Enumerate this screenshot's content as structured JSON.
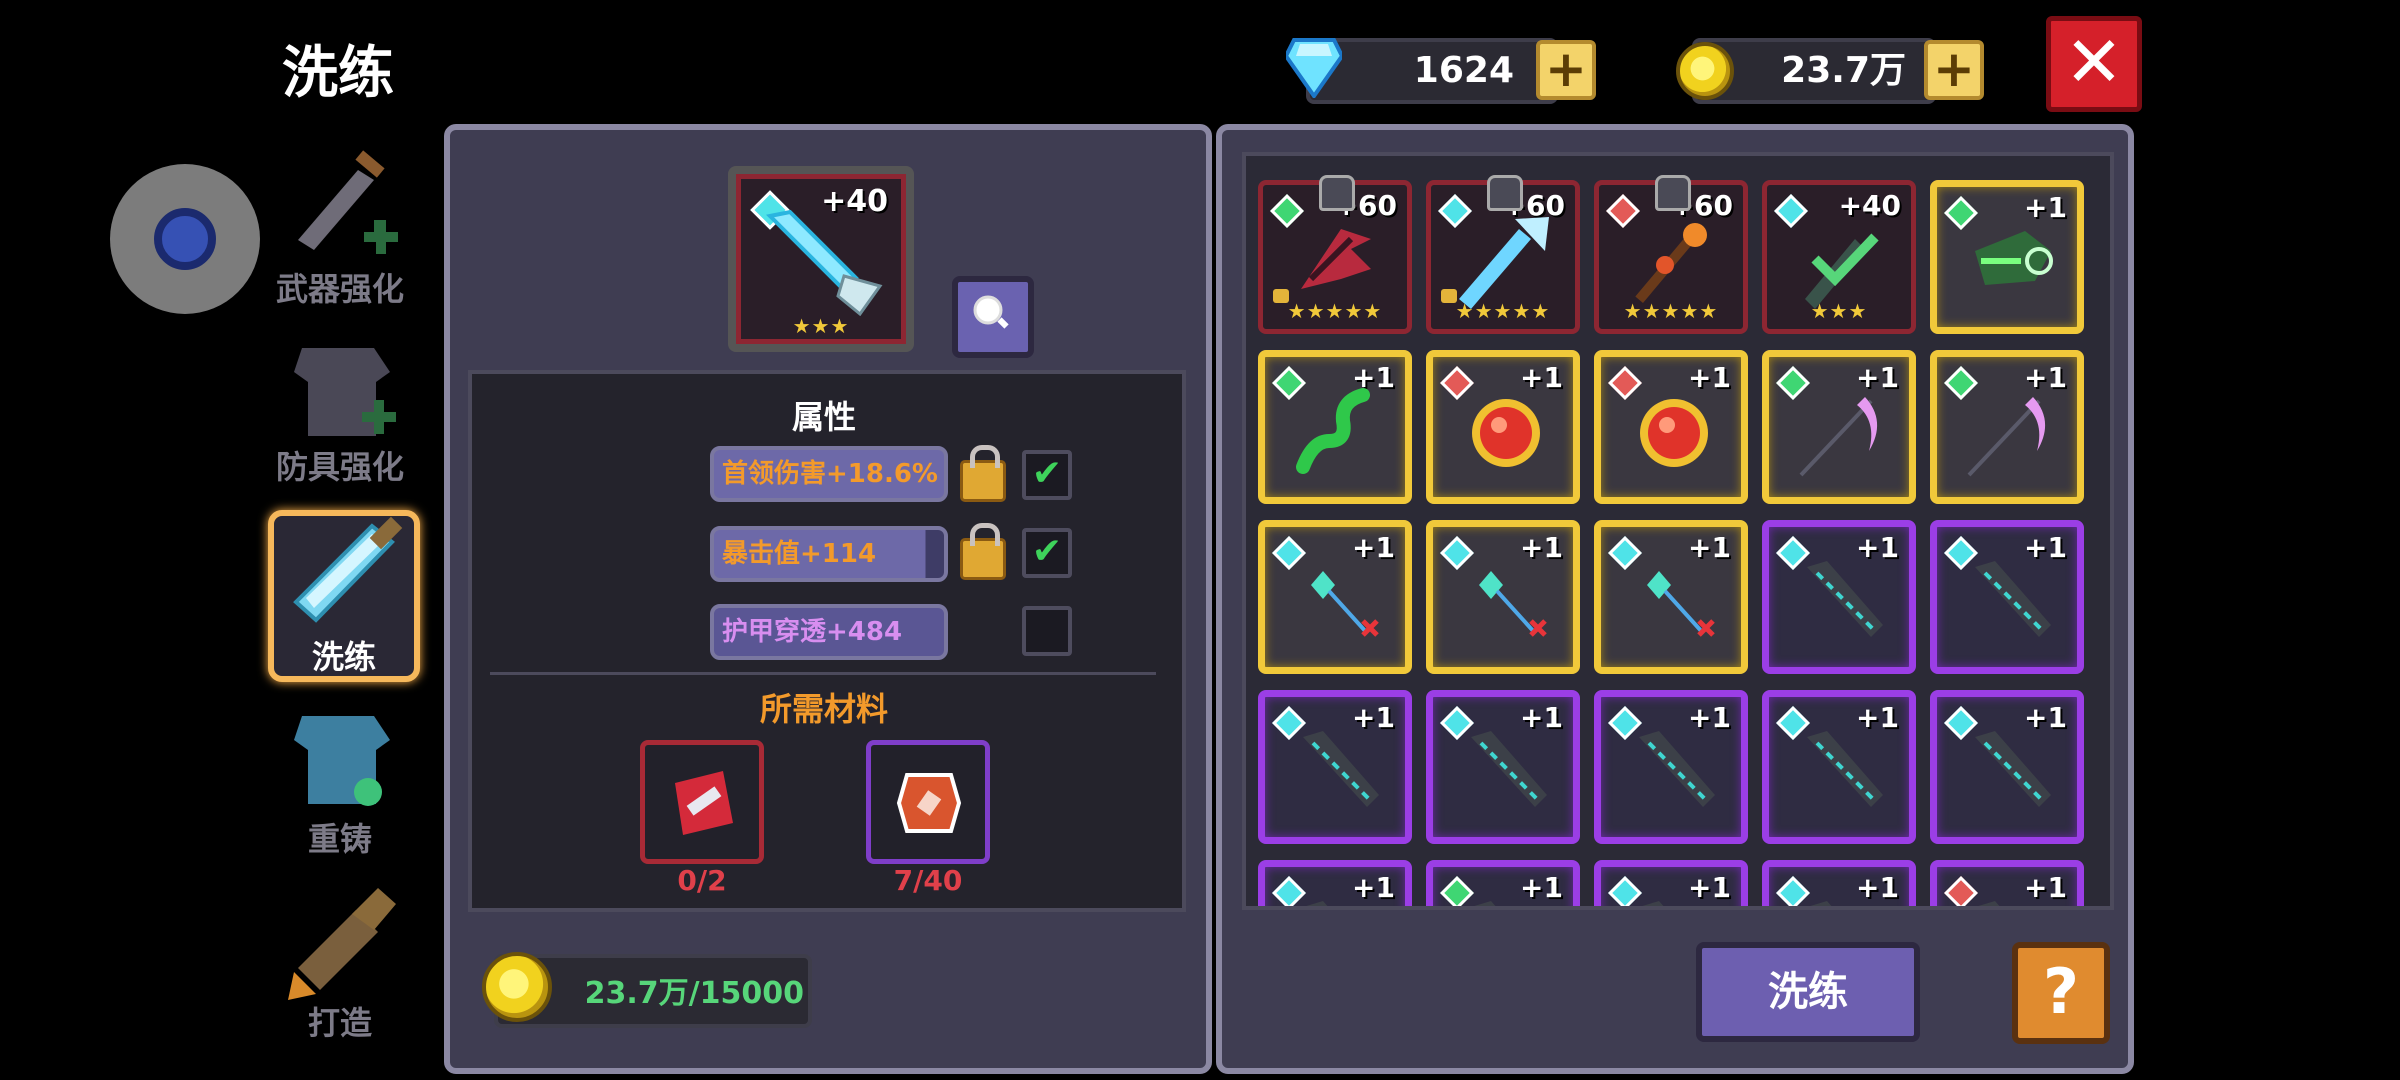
{
  "title": "洗练",
  "currency": {
    "gems": "1624",
    "coins": "23.7万"
  },
  "nav": [
    {
      "label": "武器强化",
      "icon": "sword-upgrade-icon"
    },
    {
      "label": "防具强化",
      "icon": "armor-upgrade-icon"
    },
    {
      "label": "洗练",
      "icon": "refine-crystal-sword-icon",
      "active": true
    },
    {
      "label": "重铸",
      "icon": "recast-armor-icon"
    },
    {
      "label": "打造",
      "icon": "forge-rocket-icon"
    }
  ],
  "selected_item": {
    "level": "+40",
    "stars": "★★★",
    "icon": "ice-spear-icon"
  },
  "attributes": {
    "title": "属性",
    "items": [
      {
        "text": "首领伤害+18.6%",
        "locked": true,
        "checked": true
      },
      {
        "text": "暴击值+114",
        "locked": true,
        "checked": true
      },
      {
        "text": "护甲穿透+484",
        "locked": false,
        "checked": false
      }
    ]
  },
  "materials": {
    "title": "所需材料",
    "items": [
      {
        "count": "0/2",
        "icon": "red-scroll-material-icon"
      },
      {
        "count": "7/40",
        "icon": "orange-stone-material-icon"
      }
    ]
  },
  "cost": "23.7万/15000",
  "inventory": [
    {
      "level": "+60",
      "stars": "★★★★★",
      "frame": "red",
      "icon": "crimson-scythe-icon",
      "gem": "#3fd673",
      "locked": true
    },
    {
      "level": "+60",
      "stars": "★★★★★",
      "frame": "red",
      "icon": "ice-spear-icon",
      "gem": "#4fe3e8",
      "locked": true
    },
    {
      "level": "+60",
      "stars": "★★★★★",
      "frame": "red",
      "icon": "flame-staff-icon",
      "gem": "#e35a57",
      "locked": false
    },
    {
      "level": "+40",
      "stars": "★★★",
      "frame": "red",
      "icon": "spear-equipped-check-icon",
      "gem": "#4fe3e8",
      "locked": false
    },
    {
      "level": "+1",
      "stars": "",
      "frame": "gold",
      "icon": "green-gauntlet-icon",
      "gem": "#3fd673",
      "locked": false
    },
    {
      "level": "+1",
      "stars": "",
      "frame": "gold",
      "icon": "green-serpent-icon",
      "gem": "#3fd673",
      "locked": false
    },
    {
      "level": "+1",
      "stars": "",
      "frame": "gold",
      "icon": "red-sun-orb-icon",
      "gem": "#e35a57",
      "locked": false
    },
    {
      "level": "+1",
      "stars": "",
      "frame": "gold",
      "icon": "red-sun-orb-icon",
      "gem": "#e35a57",
      "locked": false
    },
    {
      "level": "+1",
      "stars": "",
      "frame": "gold",
      "icon": "pink-scythe-icon",
      "gem": "#3fd673",
      "locked": false
    },
    {
      "level": "+1",
      "stars": "",
      "frame": "gold",
      "icon": "pink-scythe-icon",
      "gem": "#3fd673",
      "locked": false
    },
    {
      "level": "+1",
      "stars": "",
      "frame": "gold",
      "icon": "crystal-wand-icon",
      "gem": "#4fe3e8",
      "locked": false
    },
    {
      "level": "+1",
      "stars": "",
      "frame": "gold",
      "icon": "crystal-wand-icon",
      "gem": "#4fe3e8",
      "locked": false
    },
    {
      "level": "+1",
      "stars": "",
      "frame": "gold",
      "icon": "crystal-wand-icon",
      "gem": "#4fe3e8",
      "locked": false
    },
    {
      "level": "+1",
      "stars": "",
      "frame": "purple",
      "icon": "dark-lance-icon",
      "gem": "#4fe3e8",
      "locked": false
    },
    {
      "level": "+1",
      "stars": "",
      "frame": "purple",
      "icon": "dark-lance-icon",
      "gem": "#4fe3e8",
      "locked": false
    },
    {
      "level": "+1",
      "stars": "",
      "frame": "purple",
      "icon": "dark-lance-icon",
      "gem": "#4fe3e8",
      "locked": false
    },
    {
      "level": "+1",
      "stars": "",
      "frame": "purple",
      "icon": "dark-lance-icon",
      "gem": "#4fe3e8",
      "locked": false
    },
    {
      "level": "+1",
      "stars": "",
      "frame": "purple",
      "icon": "dark-lance-icon",
      "gem": "#4fe3e8",
      "locked": false
    },
    {
      "level": "+1",
      "stars": "",
      "frame": "purple",
      "icon": "dark-lance-icon",
      "gem": "#4fe3e8",
      "locked": false
    },
    {
      "level": "+1",
      "stars": "",
      "frame": "purple",
      "icon": "dark-lance-icon",
      "gem": "#4fe3e8",
      "locked": false
    },
    {
      "level": "+1",
      "stars": "",
      "frame": "purple",
      "icon": "dark-lance-icon",
      "gem": "#4fe3e8",
      "locked": false
    },
    {
      "level": "+1",
      "stars": "",
      "frame": "purple",
      "icon": "dark-lance-icon",
      "gem": "#3fd673",
      "locked": false
    },
    {
      "level": "+1",
      "stars": "",
      "frame": "purple",
      "icon": "dark-lance-icon",
      "gem": "#4fe3e8",
      "locked": false
    },
    {
      "level": "+1",
      "stars": "",
      "frame": "purple",
      "icon": "dark-lance-icon",
      "gem": "#4fe3e8",
      "locked": false
    },
    {
      "level": "+1",
      "stars": "",
      "frame": "purple",
      "icon": "dark-lance-icon",
      "gem": "#e35a57",
      "locked": false
    }
  ],
  "buttons": {
    "refine": "洗练",
    "help": "?",
    "close": "✕"
  }
}
